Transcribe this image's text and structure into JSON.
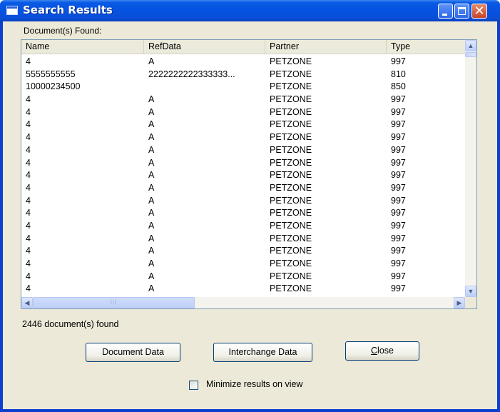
{
  "window": {
    "title": "Search Results"
  },
  "documents_found_label": "Document(s) Found:",
  "columns": [
    "Name",
    "RefData",
    "Partner",
    "Type"
  ],
  "rows": [
    {
      "name": "4",
      "refdata": "A",
      "partner": "PETZONE",
      "type": "997"
    },
    {
      "name": "5555555555",
      "refdata": "2222222222333333...",
      "partner": "PETZONE",
      "type": "810"
    },
    {
      "name": "10000234500",
      "refdata": "",
      "partner": "PETZONE",
      "type": "850"
    },
    {
      "name": "4",
      "refdata": "A",
      "partner": "PETZONE",
      "type": "997"
    },
    {
      "name": "4",
      "refdata": "A",
      "partner": "PETZONE",
      "type": "997"
    },
    {
      "name": "4",
      "refdata": "A",
      "partner": "PETZONE",
      "type": "997"
    },
    {
      "name": "4",
      "refdata": "A",
      "partner": "PETZONE",
      "type": "997"
    },
    {
      "name": "4",
      "refdata": "A",
      "partner": "PETZONE",
      "type": "997"
    },
    {
      "name": "4",
      "refdata": "A",
      "partner": "PETZONE",
      "type": "997"
    },
    {
      "name": "4",
      "refdata": "A",
      "partner": "PETZONE",
      "type": "997"
    },
    {
      "name": "4",
      "refdata": "A",
      "partner": "PETZONE",
      "type": "997"
    },
    {
      "name": "4",
      "refdata": "A",
      "partner": "PETZONE",
      "type": "997"
    },
    {
      "name": "4",
      "refdata": "A",
      "partner": "PETZONE",
      "type": "997"
    },
    {
      "name": "4",
      "refdata": "A",
      "partner": "PETZONE",
      "type": "997"
    },
    {
      "name": "4",
      "refdata": "A",
      "partner": "PETZONE",
      "type": "997"
    },
    {
      "name": "4",
      "refdata": "A",
      "partner": "PETZONE",
      "type": "997"
    },
    {
      "name": "4",
      "refdata": "A",
      "partner": "PETZONE",
      "type": "997"
    },
    {
      "name": "4",
      "refdata": "A",
      "partner": "PETZONE",
      "type": "997"
    },
    {
      "name": "4",
      "refdata": "A",
      "partner": "PETZONE",
      "type": "997"
    }
  ],
  "status_text": "2446 document(s) found",
  "buttons": {
    "document_data": "Document Data",
    "interchange_data": "Interchange Data",
    "close": "Close"
  },
  "minimize_checkbox": {
    "label": "Minimize results on view",
    "checked": false
  },
  "icons": {
    "minimize": "minimize-icon",
    "maximize": "maximize-icon",
    "close": "close-icon",
    "scroll_up": "arrow-up-icon",
    "scroll_down": "arrow-down-icon",
    "scroll_left": "arrow-left-icon",
    "scroll_right": "arrow-right-icon"
  },
  "colors": {
    "titlebar": "#0553e0",
    "dialog_bg": "#ece9d8",
    "close_button": "#c8452a"
  }
}
